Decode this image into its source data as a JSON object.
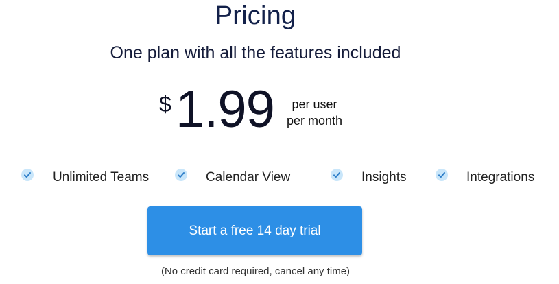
{
  "header": {
    "title": "Pricing",
    "subtitle": "One plan with all the features included"
  },
  "price": {
    "currency": "$",
    "amount": "1.99",
    "per_line1": "per user",
    "per_line2": "per month"
  },
  "features": [
    {
      "label": "Unlimited Teams",
      "icon": "check-circle-icon"
    },
    {
      "label": "Calendar View",
      "icon": "check-circle-icon"
    },
    {
      "label": "Insights",
      "icon": "check-circle-icon"
    },
    {
      "label": "Integrations",
      "icon": "check-circle-icon"
    }
  ],
  "cta": {
    "label": "Start a free 14 day trial",
    "note": "(No credit card required, cancel any time)"
  },
  "colors": {
    "accent": "#2d8fe6",
    "check_bg": "#c9e6fa",
    "check_mark": "#2f7fc9",
    "heading": "#13214a"
  }
}
